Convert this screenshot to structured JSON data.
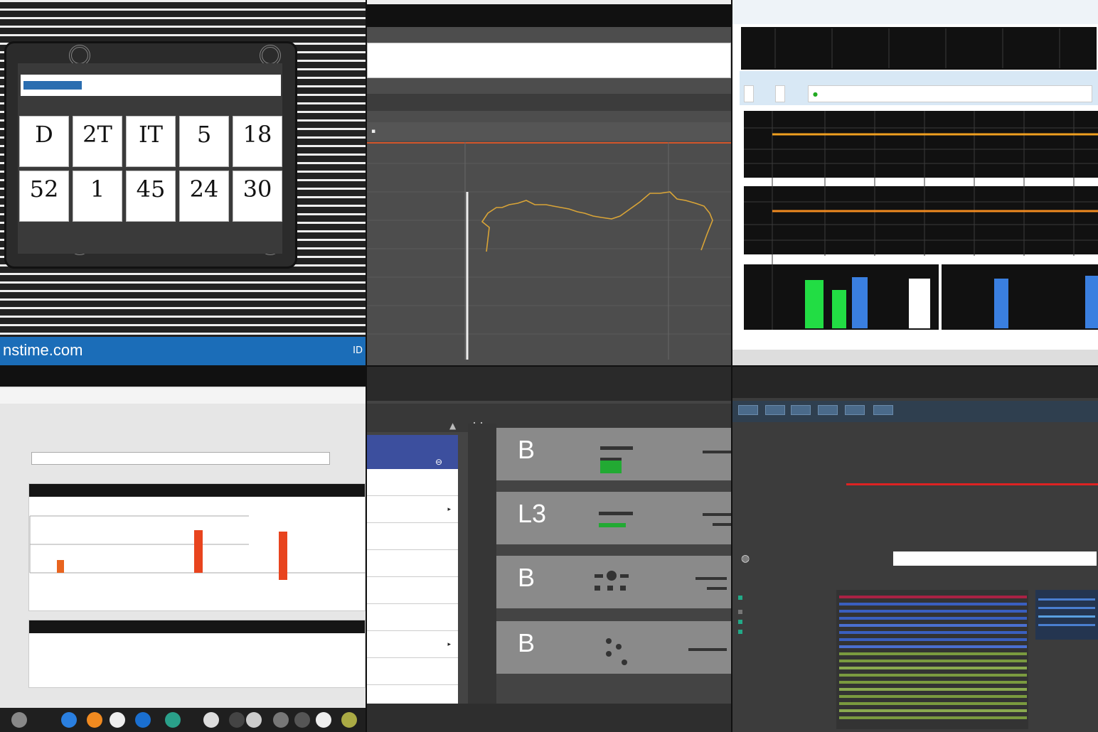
{
  "panel1": {
    "address_button": "",
    "address_text": "",
    "tiles": [
      {
        "num": "D",
        "cap": ""
      },
      {
        "num": "2T",
        "cap": ""
      },
      {
        "num": "IT",
        "cap": ""
      },
      {
        "num": "5",
        "cap": ""
      },
      {
        "num": "18",
        "cap": ""
      },
      {
        "num": "52",
        "cap": ""
      },
      {
        "num": "1",
        "cap": ""
      },
      {
        "num": "45",
        "cap": ""
      },
      {
        "num": "24",
        "cap": ""
      },
      {
        "num": "30",
        "cap": ""
      }
    ],
    "brand": "nstime.com",
    "image_id": "ID"
  },
  "panel2": {
    "search_text": "",
    "toolbar_text": "",
    "subbar_label": ""
  },
  "panel3": {
    "title": "",
    "tabs": [
      "",
      ""
    ],
    "search_label": "",
    "status": "",
    "colors": {
      "orange": "#f0a020",
      "green": "#22dd44",
      "blue": "#3a7fe0"
    }
  },
  "panel4": {
    "menu_left": "",
    "menu_right": "",
    "tree": [
      "",
      "",
      ""
    ],
    "heading": "",
    "heading_right": "",
    "url": "",
    "card1_title": "",
    "chart_title": "",
    "bar_labels": [
      "",
      "",
      "",
      "",
      ""
    ],
    "value_label": "",
    "card2_title": "",
    "line1": "",
    "line2": "",
    "line3": ""
  },
  "panel5": {
    "top_left": "",
    "top_right": "",
    "menu_head": "",
    "menu_items": [
      {
        "label": "",
        "chev": ""
      },
      {
        "label": "",
        "chev": "▸"
      },
      {
        "label": "",
        "chev": ""
      },
      {
        "label": "",
        "chev": ""
      },
      {
        "label": "",
        "chev": ""
      },
      {
        "label": "",
        "chev": ""
      },
      {
        "label": "",
        "chev": "▸"
      },
      {
        "label": "",
        "chev": ""
      }
    ],
    "tile_letters": [
      "B",
      "L3",
      "B",
      "B"
    ],
    "bottom": ""
  },
  "panel6": {
    "title": "",
    "path": "",
    "section1": "",
    "row1": "",
    "row2": "",
    "row3": "",
    "row4": "",
    "row5": "",
    "input_text": "",
    "files": [
      "",
      "",
      "",
      "",
      "",
      "",
      "",
      "",
      "",
      "",
      "",
      ""
    ]
  }
}
